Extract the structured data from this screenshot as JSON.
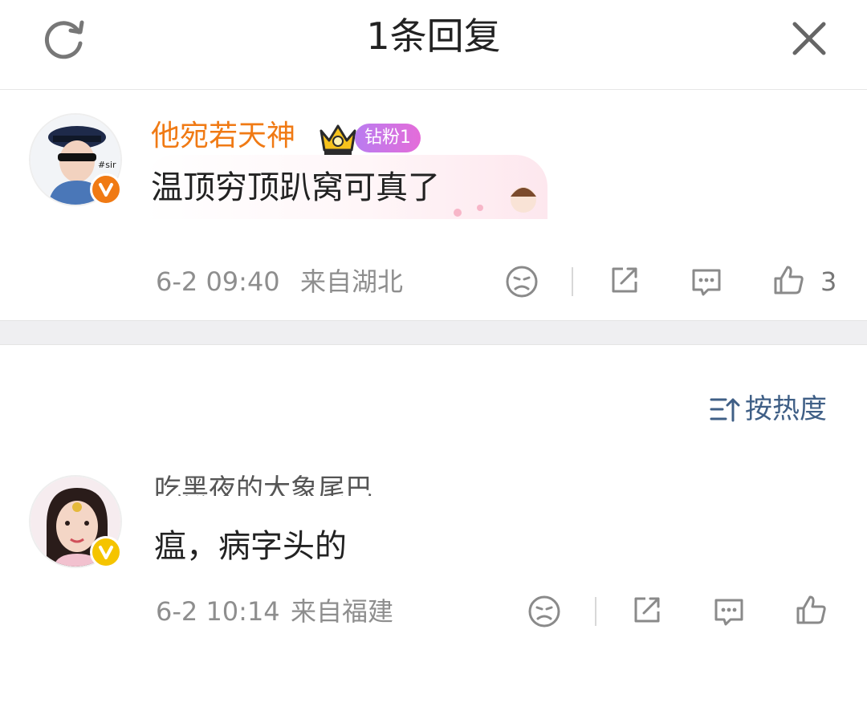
{
  "header": {
    "title": "1条回复",
    "refresh_icon": "refresh-icon",
    "close_icon": "close-icon"
  },
  "main_comment": {
    "username": "他宛若天神",
    "fan_badge": "钻粉1",
    "text": "温顶穷顶趴窝可真了",
    "time": "6-2 09:40",
    "location": "来自湖北",
    "like_count": "3",
    "verified_color": "#f07a14",
    "username_color": "#f07a14"
  },
  "sort": {
    "label": "按热度",
    "icon": "sort-icon"
  },
  "reply": {
    "username": "吃黑夜的大象尾巴",
    "text": "瘟，病字头的",
    "time": "6-2 10:14",
    "location": "来自福建",
    "verified_color": "#f5c400"
  },
  "colors": {
    "accent_blue": "#3f5f86",
    "meta_gray": "#8e8e8e",
    "separator": "#efeff1"
  }
}
